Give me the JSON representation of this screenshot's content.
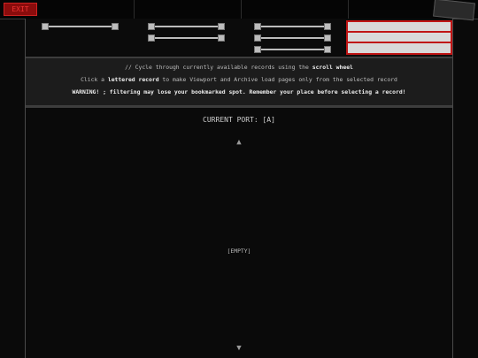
{
  "topbar": {
    "exit_label": "EXIT"
  },
  "info": {
    "line1_pre": "// Cycle through currently available records using the ",
    "line1_bold": "scroll wheel",
    "line2_pre": "Click a ",
    "line2_bold": "lettered record",
    "line2_post": " to make Viewport and Archive load pages only from the selected record",
    "line3_bold": "WARNING! ; filtering may lose your bookmarked spot. Remember your place before selecting a record!"
  },
  "viewport": {
    "title": "CURRENT PORT: [A]",
    "up_arrow": "▲",
    "down_arrow": "▼",
    "empty_text": "[EMPTY]"
  },
  "colors": {
    "accent_red": "#c01515",
    "background": "#0a0a0a",
    "panel": "#1c1c1c"
  }
}
